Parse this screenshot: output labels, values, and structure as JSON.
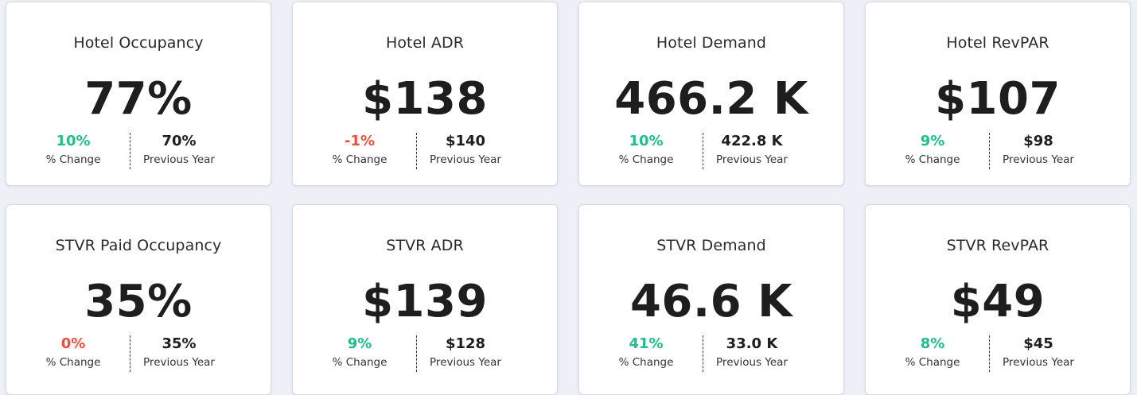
{
  "cards": [
    {
      "title": "Hotel Occupancy",
      "value": "77%",
      "change": "10%",
      "change_label": "% Change",
      "previous": "70%",
      "previous_label": "Previous Year",
      "change_color": "#1dbf8a"
    },
    {
      "title": "Hotel ADR",
      "value": "$138",
      "change": "-1%",
      "change_label": "% Change",
      "previous": "$140",
      "previous_label": "Previous Year",
      "change_color": "#ee4e3a"
    },
    {
      "title": "Hotel Demand",
      "value": "466.2 K",
      "change": "10%",
      "change_label": "% Change",
      "previous": "422.8 K",
      "previous_label": "Previous Year",
      "change_color": "#1dbf8a"
    },
    {
      "title": "Hotel RevPAR",
      "value": "$107",
      "change": "9%",
      "change_label": "% Change",
      "previous": "$98",
      "previous_label": "Previous Year",
      "change_color": "#1dbf8a"
    },
    {
      "title": "STVR Paid Occupancy",
      "value": "35%",
      "change": "0%",
      "change_label": "% Change",
      "previous": "35%",
      "previous_label": "Previous Year",
      "change_color": "#ee4e3a"
    },
    {
      "title": "STVR ADR",
      "value": "$139",
      "change": "9%",
      "change_label": "% Change",
      "previous": "$128",
      "previous_label": "Previous Year",
      "change_color": "#1dbf8a"
    },
    {
      "title": "STVR Demand",
      "value": "46.6 K",
      "change": "41%",
      "change_label": "% Change",
      "previous": "33.0 K",
      "previous_label": "Previous Year",
      "change_color": "#1dbf8a"
    },
    {
      "title": "STVR RevPAR",
      "value": "$49",
      "change": "8%",
      "change_label": "% Change",
      "previous": "$45",
      "previous_label": "Previous Year",
      "change_color": "#1dbf8a"
    }
  ]
}
